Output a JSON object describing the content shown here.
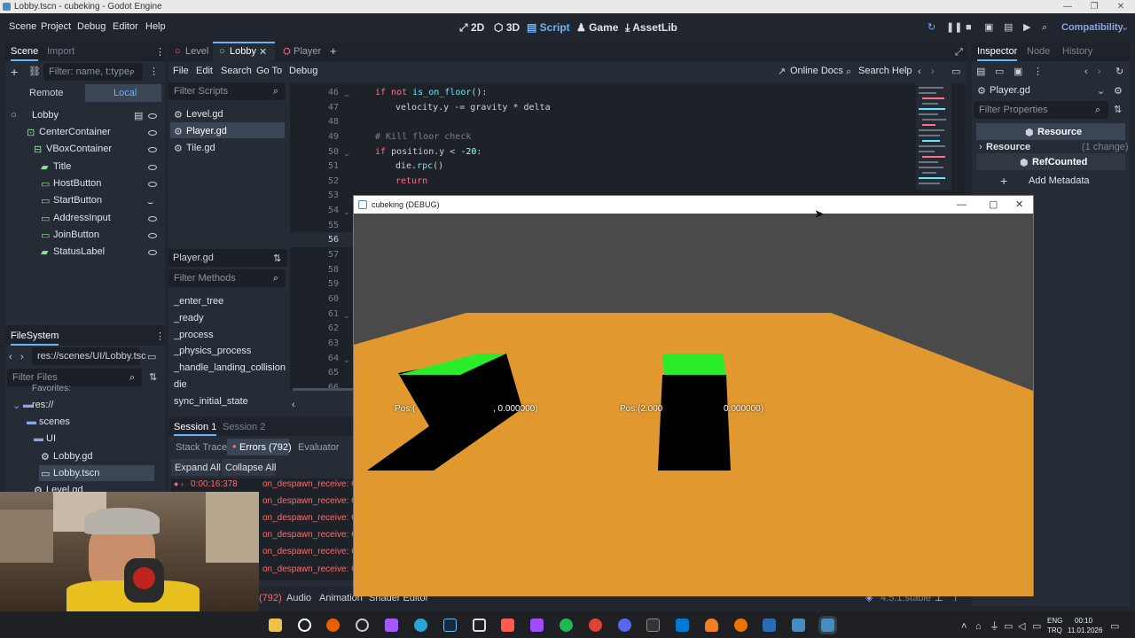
{
  "window": {
    "title": "Lobby.tscn - cubeking - Godot Engine"
  },
  "menu": {
    "items": [
      "Scene",
      "Project",
      "Debug",
      "Editor",
      "Help"
    ]
  },
  "main_buttons": {
    "b2d": "2D",
    "b3d": "3D",
    "script": "Script",
    "game": "Game",
    "assetlib": "AssetLib"
  },
  "renderer": "Compatibility",
  "scene_dock": {
    "tabs": [
      "Scene",
      "Import"
    ],
    "filter_placeholder": "Filter: name, t:type,",
    "remote": "Remote",
    "local": "Local",
    "tree": [
      "Lobby",
      "CenterContainer",
      "VBoxContainer",
      "Title",
      "HostButton",
      "StartButton",
      "AddressInput",
      "JoinButton",
      "StatusLabel"
    ]
  },
  "filesystem": {
    "title": "FileSystem",
    "path": "res://scenes/UI/Lobby.tsc",
    "filter_placeholder": "Filter Files",
    "items": [
      "Favorites:",
      "res://",
      "scenes",
      "UI",
      "Lobby.gd",
      "Lobby.tscn",
      "Level.gd"
    ]
  },
  "editor_tabs": [
    "Level",
    "Lobby",
    "Player"
  ],
  "script_menu": [
    "File",
    "Edit",
    "Search",
    "Go To",
    "Debug"
  ],
  "online_docs": "Online Docs",
  "search_help": "Search Help",
  "scripts": {
    "filter_placeholder": "Filter Scripts",
    "list": [
      "Level.gd",
      "Player.gd",
      "Tile.gd"
    ],
    "current": "Player.gd",
    "methods_placeholder": "Filter Methods",
    "methods": [
      "_enter_tree",
      "_ready",
      "_process",
      "_physics_process",
      "_handle_landing_collision",
      "die",
      "sync_initial_state"
    ]
  },
  "code": {
    "line_numbers": [
      "46",
      "47",
      "48",
      "49",
      "50",
      "51",
      "52",
      "53",
      "54",
      "55",
      "56",
      "57",
      "58",
      "59",
      "60",
      "61",
      "62",
      "63",
      "64",
      "65",
      "66"
    ],
    "l46_kw": "if not",
    "l46_fn": "is_on_floor",
    "l46_rest": "():",
    "l47": "velocity.y -= gravity * delta",
    "l49": "# Kill floor check",
    "l50_kw": "if",
    "l50_rest": "position.y <",
    "l50_num": "-20",
    "l50_end": ":",
    "l51_a": "die.",
    "l51_fn": "rpc",
    "l51_b": "()",
    "l52": "return"
  },
  "debugger": {
    "sessions": [
      "Session 1",
      "Session 2"
    ],
    "tabs": [
      "Stack Trace",
      "Errors (792)",
      "Evaluator"
    ],
    "expand_all": "Expand All",
    "collapse_all": "Collapse All",
    "first_time": "0:00:16:378",
    "errors": [
      "on_despawn_receive: C",
      "on_despawn_receive: C",
      "on_despawn_receive: C",
      "on_despawn_receive: C",
      "on_despawn_receive: C",
      "on_despawn_receive: C"
    ]
  },
  "bottom_panel": {
    "count": "(792)",
    "audio": "Audio",
    "animation": "Animation",
    "shader": "Shader Editor",
    "version": "4.5.1.stable"
  },
  "inspector": {
    "tabs": [
      "Inspector",
      "Node",
      "History"
    ],
    "file": "Player.gd",
    "filter_placeholder": "Filter Properties",
    "resource_header": "Resource",
    "resource": "Resource",
    "change": "(1 change)",
    "refcounted": "RefCounted",
    "add_metadata": "Add Metadata"
  },
  "game_window": {
    "title": "cubeking (DEBUG)",
    "label_left_a": "Pos:(",
    "label_left_b": ", 0.000000)",
    "label_right_a": "Pos:(2.000",
    "label_right_b": "0.000000)",
    "colors": {
      "ground": "#e1992f",
      "sky": "#4a4a4a",
      "cube_top": "#2aec2a",
      "shadow": "#000000"
    }
  },
  "taskbar": {
    "lang1": "ENG",
    "lang2": "TRQ",
    "time": "00:10",
    "date": "11.01.2026"
  }
}
